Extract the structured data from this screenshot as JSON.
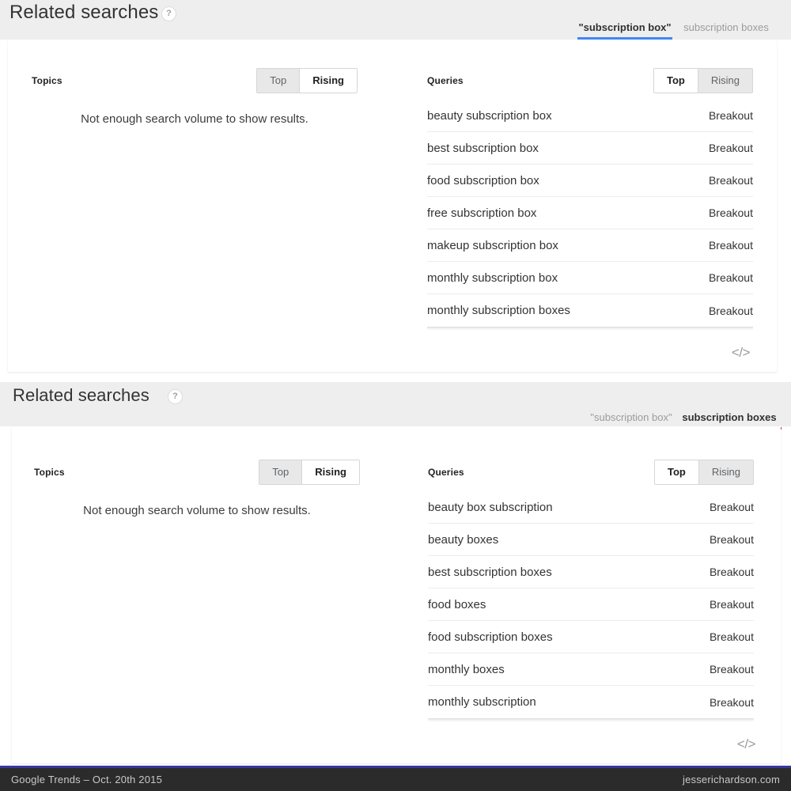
{
  "accents": {
    "blue": "#4285f4",
    "red": "#e8382b",
    "page_bg": "#ffffff",
    "panel_header_bg": "#eeeeee",
    "card_bg": "#ffffff",
    "footer_bg": "#2b2b2b",
    "footer_rule": "#3a37a0"
  },
  "panels": [
    {
      "title": "Related searches",
      "help_icon": "?",
      "help_icon_name": "help-icon",
      "active_tab_color": "#4285f4",
      "tabs": [
        {
          "label": "\"subscription box\"",
          "active": true
        },
        {
          "label": "subscription boxes",
          "active": false
        }
      ],
      "topics": {
        "title": "Topics",
        "toggle": [
          {
            "label": "Top",
            "selected": false
          },
          {
            "label": "Rising",
            "selected": true
          }
        ],
        "empty_message": "Not enough search volume to show results."
      },
      "queries": {
        "title": "Queries",
        "toggle": [
          {
            "label": "Top",
            "selected": true
          },
          {
            "label": "Rising",
            "selected": false
          }
        ],
        "rows": [
          {
            "term": "beauty subscription box",
            "value": "Breakout"
          },
          {
            "term": "best subscription box",
            "value": "Breakout"
          },
          {
            "term": "food subscription box",
            "value": "Breakout"
          },
          {
            "term": "free subscription box",
            "value": "Breakout"
          },
          {
            "term": "makeup subscription box",
            "value": "Breakout"
          },
          {
            "term": "monthly subscription box",
            "value": "Breakout"
          },
          {
            "term": "monthly subscription boxes",
            "value": "Breakout"
          }
        ]
      },
      "embed_icon": "</>"
    },
    {
      "title": "Related searches",
      "help_icon": "?",
      "help_icon_name": "help-icon",
      "active_tab_color": "#e8382b",
      "tabs": [
        {
          "label": "\"subscription box\"",
          "active": false
        },
        {
          "label": "subscription boxes",
          "active": true
        }
      ],
      "topics": {
        "title": "Topics",
        "toggle": [
          {
            "label": "Top",
            "selected": false
          },
          {
            "label": "Rising",
            "selected": true
          }
        ],
        "empty_message": "Not enough search volume to show results."
      },
      "queries": {
        "title": "Queries",
        "toggle": [
          {
            "label": "Top",
            "selected": true
          },
          {
            "label": "Rising",
            "selected": false
          }
        ],
        "rows": [
          {
            "term": "beauty box subscription",
            "value": "Breakout"
          },
          {
            "term": "beauty boxes",
            "value": "Breakout"
          },
          {
            "term": "best subscription boxes",
            "value": "Breakout"
          },
          {
            "term": "food boxes",
            "value": "Breakout"
          },
          {
            "term": "food subscription boxes",
            "value": "Breakout"
          },
          {
            "term": "monthly boxes",
            "value": "Breakout"
          },
          {
            "term": "monthly subscription",
            "value": "Breakout"
          }
        ]
      },
      "embed_icon": "</>"
    }
  ],
  "footer": {
    "left": "Google Trends – Oct. 20th 2015",
    "right": "jesserichardson.com"
  }
}
